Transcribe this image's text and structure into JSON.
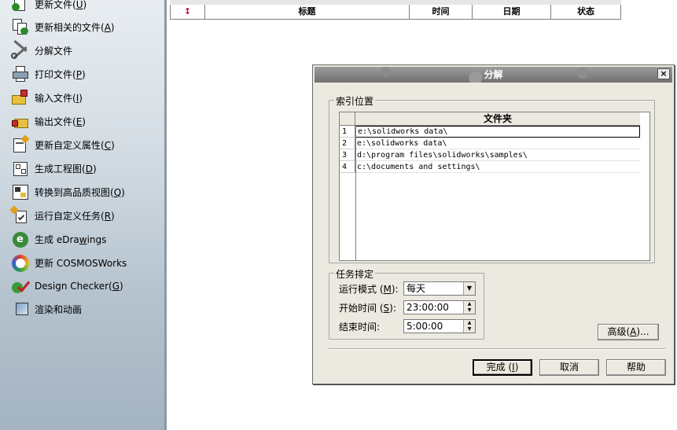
{
  "task_pane": {
    "items": [
      {
        "text": "更新文件",
        "key": "U",
        "icon": "document-update-icon"
      },
      {
        "text": "更新相关的文件",
        "key": "A",
        "icon": "linked-files-update-icon"
      },
      {
        "text": "分解文件",
        "key": "",
        "icon": "scissors-icon"
      },
      {
        "text": "打印文件",
        "key": "P",
        "icon": "printer-icon"
      },
      {
        "text": "输入文件",
        "key": "I",
        "icon": "import-folder-icon"
      },
      {
        "text": "输出文件",
        "key": "E",
        "icon": "export-folder-icon"
      },
      {
        "text": "更新自定义属性",
        "key": "C",
        "icon": "custom-properties-icon"
      },
      {
        "text": "生成工程图",
        "key": "D",
        "icon": "drawing-icon"
      },
      {
        "text": "转换到高品质视图",
        "key": "Q",
        "icon": "high-quality-view-icon"
      },
      {
        "text": "运行自定义任务",
        "key": "R",
        "icon": "custom-task-icon"
      },
      {
        "text": "生成 eDrawings",
        "key": "w",
        "icon": "edrawings-icon"
      },
      {
        "text": "更新 COSMOSWorks",
        "key": "",
        "icon": "cosmosworks-icon"
      },
      {
        "text": "Design Checker",
        "key": "G",
        "icon": "design-checker-icon"
      },
      {
        "text": "渲染和动画",
        "key": "",
        "icon": "render-icon"
      }
    ]
  },
  "task_grid": {
    "columns": [
      "↕",
      "标题",
      "时间",
      "日期",
      "状态"
    ]
  },
  "dialog": {
    "title": "分解",
    "close_label": "×",
    "index_group": {
      "title": "索引位置",
      "column_header": "文件夹",
      "rows": [
        {
          "num": "1",
          "path": "e:\\solidworks data\\"
        },
        {
          "num": "2",
          "path": "e:\\solidworks data\\"
        },
        {
          "num": "3",
          "path": "d:\\program files\\solidworks\\samples\\"
        },
        {
          "num": "4",
          "path": "c:\\documents and settings\\"
        }
      ]
    },
    "schedule_group": {
      "title": "任务排定",
      "run_mode_label": "运行模式",
      "run_mode_key": "M",
      "run_mode_value": "每天",
      "start_time_label": "开始时间",
      "start_time_key": "S",
      "start_time_value": "23:00:00",
      "end_time_label": "结束时间:",
      "end_time_value": "5:00:00"
    },
    "advanced_button": {
      "text": "高级",
      "key": "A",
      "suffix": "..."
    },
    "finish_button": {
      "text": "完成",
      "key": "I"
    },
    "cancel_button": {
      "text": "取消"
    },
    "help_button": {
      "text": "帮助"
    }
  }
}
